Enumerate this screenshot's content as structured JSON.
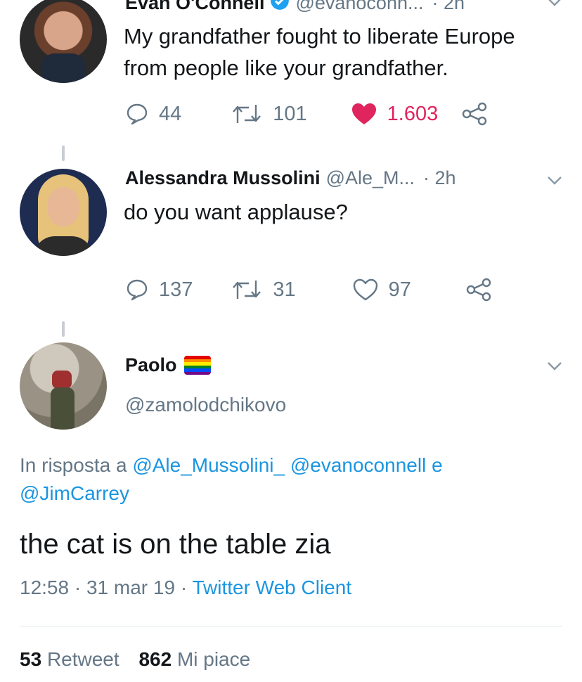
{
  "tweet1": {
    "name": "Evan O'Connell",
    "handle": "@evanoconn...",
    "time": "· 2h",
    "text_line1": "My grandfather fought to liberate Europe",
    "text_line2": "from people like your grandfather.",
    "replies": "44",
    "retweets": "101",
    "likes": "1.603",
    "liked": true
  },
  "tweet2": {
    "name": "Alessandra Mussolini",
    "handle": "@Ale_M...",
    "time": "· 2h",
    "text": "do you want applause?",
    "replies": "137",
    "retweets": "31",
    "likes": "97"
  },
  "main_tweet": {
    "name": "Paolo",
    "handle": "@zamolodchikovo",
    "reply_prefix": "In risposta a",
    "reply_to_1": "@Ale_Mussolini_",
    "reply_to_2": "@evanoconnell",
    "reply_and": "e",
    "reply_to_3": "@JimCarrey",
    "text": "the cat is on the table zia",
    "time": "12:58",
    "date": "31 mar 19",
    "sep": "·",
    "client": "Twitter Web Client",
    "retweet_count": "53",
    "retweet_label": "Retweet",
    "like_count": "862",
    "like_label": "Mi piace"
  },
  "icons": {
    "reply": "reply-icon",
    "retweet": "retweet-icon",
    "like": "heart-icon",
    "share": "share-icon",
    "verified": "verified-badge-icon",
    "chevron": "chevron-down-icon",
    "flag": "rainbow-flag-icon"
  },
  "colors": {
    "link": "#1b95e0",
    "like_active": "#e0245e",
    "secondary_text": "#657786",
    "verified": "#1da1f2"
  }
}
